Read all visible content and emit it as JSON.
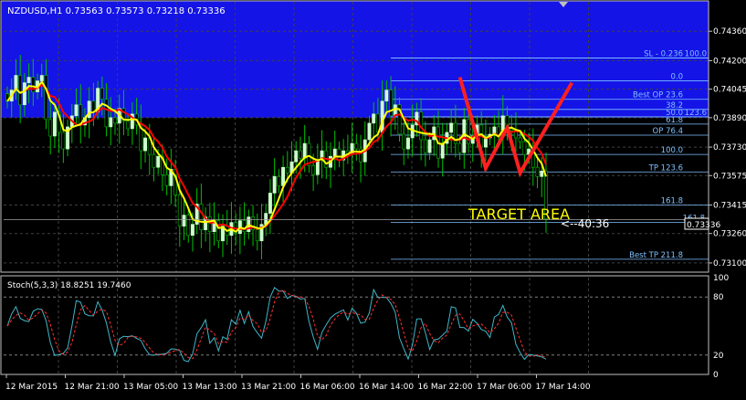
{
  "window": {
    "symbol_info": "NZDUSD,H1  0.73563 0.73573 0.73218 0.73336"
  },
  "chart_data": {
    "type": "candlestick",
    "symbol": "NZDUSD",
    "timeframe": "H1",
    "ohlc_header": {
      "open": 0.73563,
      "high": 0.73573,
      "low": 0.73218,
      "close": 0.73336
    },
    "price_axis": {
      "ylim": [
        0.7305,
        0.7452
      ],
      "ticks": [
        "0.74360",
        "0.74200",
        "0.74045",
        "0.73890",
        "0.73730",
        "0.73575",
        "0.73415",
        "0.73260",
        "0.73100"
      ],
      "current_price": "0.73336"
    },
    "time_axis": {
      "ticks": [
        "12 Mar 2015",
        "12 Mar 21:00",
        "13 Mar 05:00",
        "13 Mar 13:00",
        "13 Mar 21:00",
        "16 Mar 06:00",
        "16 Mar 14:00",
        "16 Mar 22:00",
        "17 Mar 06:00",
        "17 Mar 14:00"
      ]
    },
    "closes": [
      0.7398,
      0.7404,
      0.7412,
      0.7396,
      0.7408,
      0.7411,
      0.7403,
      0.7409,
      0.7412,
      0.7388,
      0.7379,
      0.7392,
      0.7381,
      0.7372,
      0.7384,
      0.739,
      0.7396,
      0.7385,
      0.7389,
      0.7398,
      0.7392,
      0.7405,
      0.7399,
      0.7384,
      0.7389,
      0.7386,
      0.7394,
      0.7387,
      0.7383,
      0.7391,
      0.7385,
      0.7371,
      0.7378,
      0.7369,
      0.7362,
      0.7368,
      0.7358,
      0.7352,
      0.7361,
      0.7347,
      0.733,
      0.7336,
      0.7325,
      0.7331,
      0.7342,
      0.7328,
      0.7335,
      0.7327,
      0.7333,
      0.7322,
      0.733,
      0.7325,
      0.7332,
      0.7326,
      0.7333,
      0.7327,
      0.7335,
      0.7328,
      0.7322,
      0.7331,
      0.7337,
      0.7348,
      0.7357,
      0.7352,
      0.7362,
      0.7359,
      0.7365,
      0.7371,
      0.7367,
      0.7375,
      0.7363,
      0.7358,
      0.7366,
      0.7371,
      0.7362,
      0.7368,
      0.7372,
      0.7366,
      0.7371,
      0.7369,
      0.7375,
      0.7372,
      0.7365,
      0.7377,
      0.7386,
      0.7391,
      0.7381,
      0.7398,
      0.7404,
      0.739,
      0.7396,
      0.738,
      0.7372,
      0.7378,
      0.7385,
      0.7392,
      0.7377,
      0.737,
      0.7377,
      0.7384,
      0.7367,
      0.7375,
      0.7381,
      0.7386,
      0.7375,
      0.737,
      0.7388,
      0.7375,
      0.7379,
      0.7385,
      0.7373,
      0.7378,
      0.738,
      0.7384,
      0.7379,
      0.739,
      0.7383,
      0.7382,
      0.7378,
      0.7376,
      0.7369,
      0.7372,
      0.7362,
      0.7357,
      0.736,
      0.7334
    ],
    "moving_averages": [
      {
        "color": "#ff0000",
        "role": "slow"
      },
      {
        "color": "#ffff00",
        "role": "fast"
      }
    ],
    "fib_levels": [
      {
        "label": "SL - 0.236",
        "price": 0.74215
      },
      {
        "label": "100.0",
        "price": 0.74215
      },
      {
        "label": "0.0",
        "price": 0.7409
      },
      {
        "label": "Best OP 23.6",
        "price": 0.7399
      },
      {
        "label": "38.2",
        "price": 0.73935
      },
      {
        "label": "50.0",
        "price": 0.73895
      },
      {
        "label": "123.6",
        "price": 0.73895
      },
      {
        "label": "61.8",
        "price": 0.73855
      },
      {
        "label": "OP 76.4",
        "price": 0.73795
      },
      {
        "label": "100.0",
        "price": 0.7369
      },
      {
        "label": "TP 123.6",
        "price": 0.73595
      },
      {
        "label": "161.8",
        "price": 0.73415
      },
      {
        "label": "161.8",
        "price": 0.7332
      },
      {
        "label": "Best TP 211.8",
        "price": 0.7312
      }
    ],
    "pattern_points": [
      {
        "bar": 105,
        "price": 0.7411
      },
      {
        "bar": 111,
        "price": 0.73615
      },
      {
        "bar": 116,
        "price": 0.73835
      },
      {
        "bar": 119,
        "price": 0.7359
      },
      {
        "bar": 131,
        "price": 0.7408
      }
    ],
    "pattern_color": "#ff2020",
    "annotations": {
      "target_area": "TARGET AREA",
      "countdown": "<--40:36"
    },
    "indicator": {
      "name": "Stoch(5,3,3) 18.8251 19.7460",
      "ticks": [
        "100",
        "80",
        "20",
        "0"
      ],
      "main_color": "#3fb6c8",
      "signal_color": "#ff3030"
    },
    "colors": {
      "zone": "#1414e6",
      "bull": "#ccffcc",
      "bear": "#000000",
      "wick": "#00c000",
      "grid": "#404040",
      "fib": "#80c0ff",
      "price_label": "#ffffff",
      "target_text": "#ffff00"
    }
  }
}
